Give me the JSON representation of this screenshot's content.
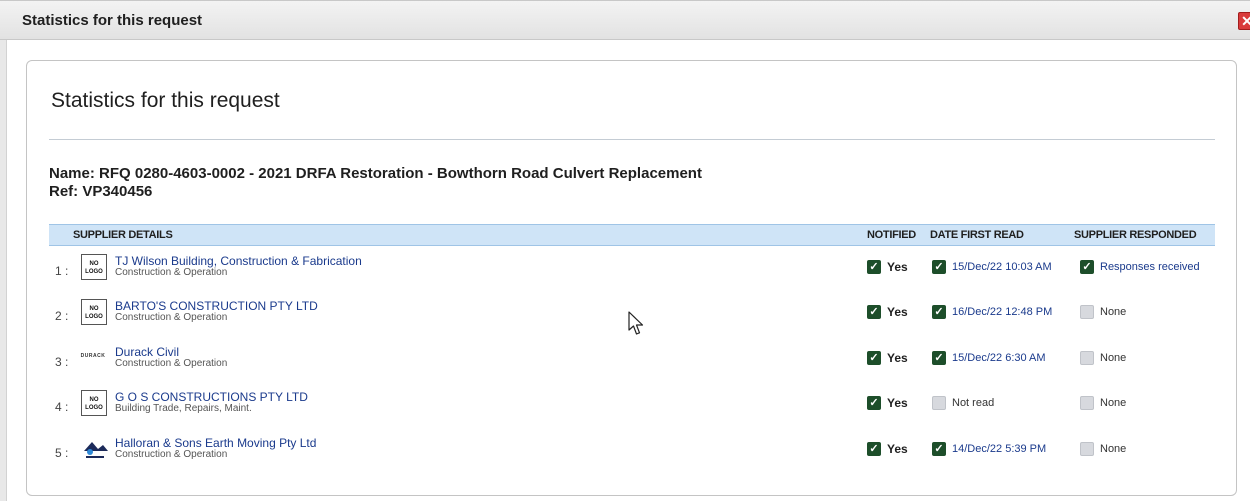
{
  "window": {
    "title": "Statistics for this request",
    "close_glyph": "✕"
  },
  "panel": {
    "title": "Statistics for this request",
    "name_line": "Name: RFQ 0280-4603-0002 - 2021 DRFA Restoration - Bowthorn Road Culvert Replacement",
    "ref_line": "Ref: VP340456"
  },
  "table": {
    "headers": {
      "supplier": "SUPPLIER DETAILS",
      "notified": "NOTIFIED",
      "date_first_read": "DATE FIRST READ",
      "supplier_responded": "SUPPLIER RESPONDED"
    },
    "rows": [
      {
        "index": "1 :",
        "logo_text": "NO LOGO",
        "logo_type": "no-logo",
        "name": "TJ Wilson Building, Construction & Fabrication",
        "category": "Construction & Operation",
        "notified": "Yes",
        "notified_checked": true,
        "date_read": "15/Dec/22 10:03 AM",
        "date_checked": true,
        "responded": "Responses received",
        "responded_checked": true
      },
      {
        "index": "2 :",
        "logo_text": "NO LOGO",
        "logo_type": "no-logo",
        "name": "BARTO'S CONSTRUCTION PTY LTD",
        "category": "Construction & Operation",
        "notified": "Yes",
        "notified_checked": true,
        "date_read": "16/Dec/22 12:48 PM",
        "date_checked": true,
        "responded": "None",
        "responded_checked": false
      },
      {
        "index": "3 :",
        "logo_text": "DURACK",
        "logo_type": "durack",
        "name": "Durack Civil",
        "category": "Construction & Operation",
        "notified": "Yes",
        "notified_checked": true,
        "date_read": "15/Dec/22 6:30 AM",
        "date_checked": true,
        "responded": "None",
        "responded_checked": false
      },
      {
        "index": "4 :",
        "logo_text": "NO LOGO",
        "logo_type": "no-logo",
        "name": "G O S CONSTRUCTIONS PTY LTD",
        "category": "Building Trade, Repairs, Maint.",
        "notified": "Yes",
        "notified_checked": true,
        "date_read": "Not read",
        "date_checked": false,
        "responded": "None",
        "responded_checked": false
      },
      {
        "index": "5 :",
        "logo_text": "HALLORAN",
        "logo_type": "halloran",
        "name": "Halloran & Sons Earth Moving Pty Ltd",
        "category": "Construction & Operation",
        "notified": "Yes",
        "notified_checked": true,
        "date_read": "14/Dec/22 5:39 PM",
        "date_checked": true,
        "responded": "None",
        "responded_checked": false
      }
    ]
  },
  "colors": {
    "header_bg": "#cfe4f7",
    "link": "#1a3a8c",
    "check": "#1d4e2a"
  }
}
